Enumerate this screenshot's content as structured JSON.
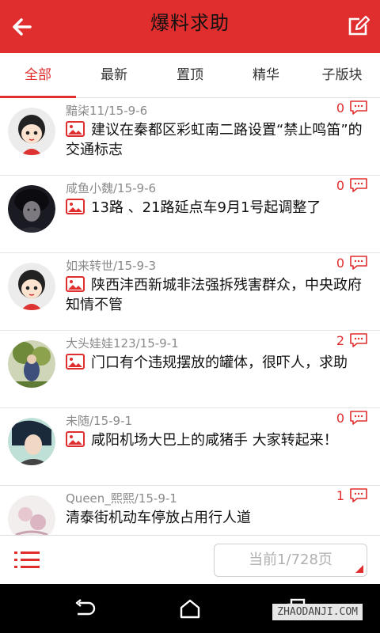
{
  "header": {
    "title": "爆料求助"
  },
  "tabs": [
    {
      "label": "全部",
      "active": true
    },
    {
      "label": "最新",
      "active": false
    },
    {
      "label": "置顶",
      "active": false
    },
    {
      "label": "精华",
      "active": false
    },
    {
      "label": "子版块",
      "active": false
    }
  ],
  "posts": [
    {
      "meta": "黯柒11/15-9-6",
      "count": "0",
      "title": "建议在秦都区彩虹南二路设置“禁止鸣笛”的交通标志",
      "has_image": true,
      "avatar": "cartoon-girl"
    },
    {
      "meta": "咸鱼小魏/15-9-6",
      "count": "0",
      "title": "13路 、21路延点车9月1号起调整了",
      "has_image": true,
      "avatar": "dark-photo"
    },
    {
      "meta": "如来转世/15-9-3",
      "count": "0",
      "title": "陕西沣西新城非法强拆残害群众，中央政府知情不管",
      "has_image": true,
      "avatar": "cartoon-girl"
    },
    {
      "meta": "大头娃娃123/15-9-1",
      "count": "2",
      "title": "门口有个违规摆放的罐体，很吓人，求助",
      "has_image": true,
      "avatar": "green-photo"
    },
    {
      "meta": "未随/15-9-1",
      "count": "0",
      "title": "咸阳机场大巴上的咸猪手 大家转起来！",
      "has_image": true,
      "avatar": "anime-photo"
    },
    {
      "meta": "Queen_熙熙/15-9-1",
      "count": "1",
      "title": "清泰街机动车停放占用行人道",
      "has_image": false,
      "avatar": "light-photo"
    }
  ],
  "footer": {
    "page_label": "当前1/728页"
  },
  "watermark": "ZHAODANJI.COM",
  "colors": {
    "accent": "#e02e2e"
  }
}
